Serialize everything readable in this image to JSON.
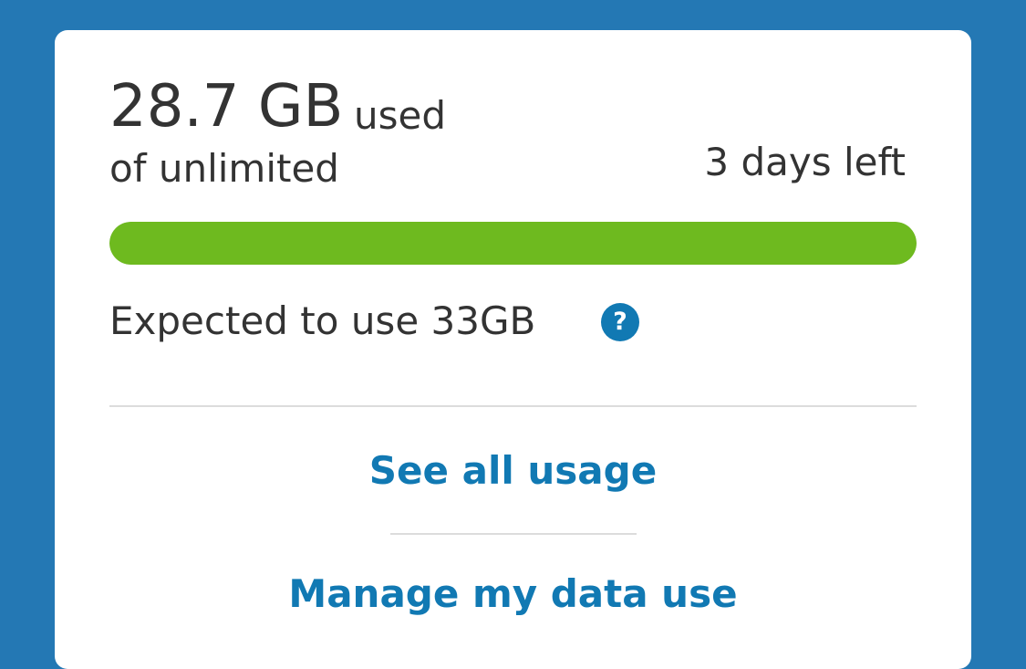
{
  "usage": {
    "amount": "28.7 GB",
    "used_label": "used",
    "of_label": "of unlimited",
    "days_left": "3 days left",
    "progress_fraction": 1.0,
    "bar_color": "#6eba1f",
    "expected": "Expected to use 33GB",
    "help_icon": "question-circle-icon",
    "help_glyph": "?"
  },
  "links": {
    "see_all_usage": "See all usage",
    "manage_data_use": "Manage my data use"
  },
  "colors": {
    "background": "#2478b4",
    "card": "#ffffff",
    "link": "#1179b3",
    "text": "#333333"
  }
}
